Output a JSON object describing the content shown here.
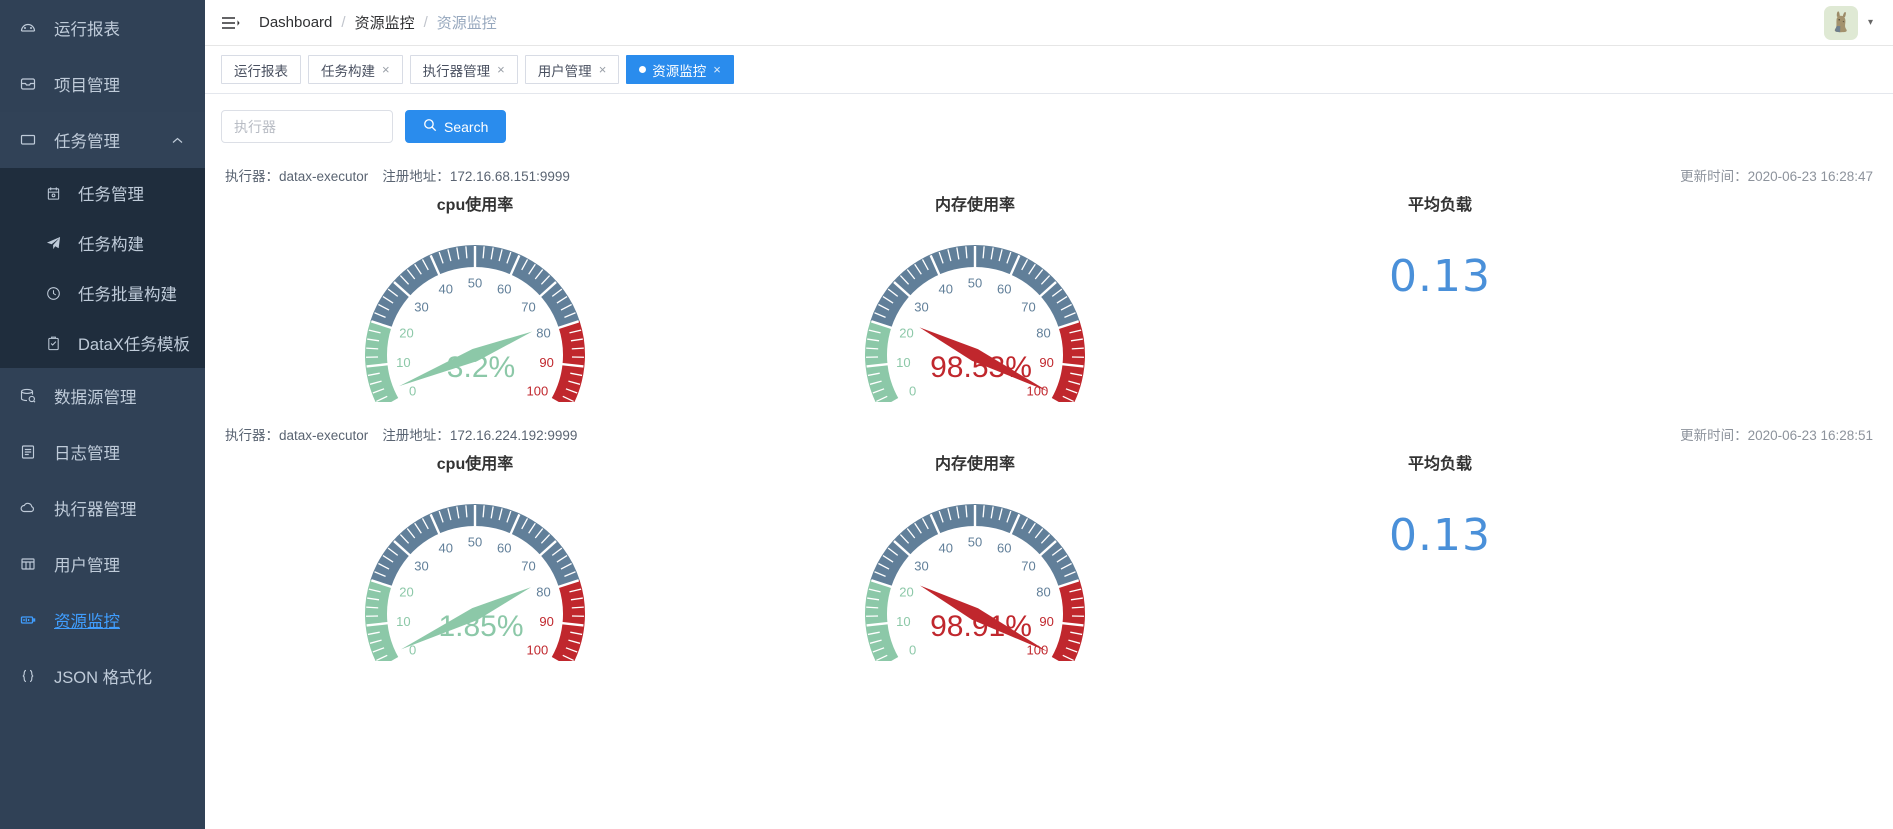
{
  "sidebar": {
    "items": [
      {
        "label": "运行报表",
        "icon": "dashboard-icon",
        "active": false
      },
      {
        "label": "项目管理",
        "icon": "project-icon",
        "active": false
      },
      {
        "label": "任务管理",
        "icon": "task-icon",
        "active": false,
        "expanded": true,
        "children": [
          {
            "label": "任务管理",
            "icon": "calendar-icon"
          },
          {
            "label": "任务构建",
            "icon": "send-icon"
          },
          {
            "label": "任务批量构建",
            "icon": "clock-icon"
          },
          {
            "label": "DataX任务模板",
            "icon": "clipboard-icon"
          }
        ]
      },
      {
        "label": "数据源管理",
        "icon": "database-icon",
        "active": false
      },
      {
        "label": "日志管理",
        "icon": "log-icon",
        "active": false
      },
      {
        "label": "执行器管理",
        "icon": "cloud-icon",
        "active": false
      },
      {
        "label": "用户管理",
        "icon": "grid-icon",
        "active": false
      },
      {
        "label": "资源监控",
        "icon": "monitor-icon",
        "active": true
      },
      {
        "label": "JSON 格式化",
        "icon": "braces-icon",
        "active": false
      }
    ]
  },
  "topbar": {
    "menu_icon": "hamburger-icon",
    "breadcrumb": [
      "Dashboard",
      "资源监控",
      "资源监控"
    ],
    "breadcrumb_separator": "/",
    "avatar_icon": "rabbit-avatar",
    "avatar_caret": "▾"
  },
  "tabs": [
    {
      "label": "运行报表",
      "closable": false,
      "active": false
    },
    {
      "label": "任务构建",
      "closable": true,
      "active": false
    },
    {
      "label": "执行器管理",
      "closable": true,
      "active": false
    },
    {
      "label": "用户管理",
      "closable": true,
      "active": false
    },
    {
      "label": "资源监控",
      "closable": true,
      "active": true
    }
  ],
  "tab_close_glyph": "×",
  "search": {
    "placeholder": "执行器",
    "value": "",
    "button_label": "Search",
    "button_icon": "search-icon"
  },
  "labels": {
    "executor_prefix": "执行器：",
    "address_prefix": "注册地址：",
    "update_prefix": "更新时间：",
    "cpu_title": "cpu使用率",
    "mem_title": "内存使用率",
    "load_title": "平均负载"
  },
  "colors": {
    "accent": "#2a8ced",
    "gauge_green": "#8cc8a8",
    "gauge_blue": "#617f99",
    "gauge_red": "#c0272d",
    "load_blue": "#4a90d9",
    "sidebar_bg": "#304156",
    "submenu_bg": "#1f2d3d"
  },
  "executors": [
    {
      "name": "datax-executor",
      "address": "172.16.68.151:9999",
      "update_time": "2020-06-23 16:28:47",
      "cpu": {
        "value": 3.2,
        "display": "3.2%"
      },
      "mem": {
        "value": 98.53,
        "display": "98.53%"
      },
      "load": {
        "value": 0.13,
        "display": "0.13"
      }
    },
    {
      "name": "datax-executor",
      "address": "172.16.224.192:9999",
      "update_time": "2020-06-23 16:28:51",
      "cpu": {
        "value": 1.85,
        "display": "1.85%"
      },
      "mem": {
        "value": 98.91,
        "display": "98.91%"
      },
      "load": {
        "value": 0.13,
        "display": "0.13"
      }
    }
  ],
  "chart_data": [
    {
      "type": "gauge",
      "title": "cpu使用率",
      "executor_index": 0,
      "value": 3.2,
      "unit": "%",
      "min": 0,
      "max": 100,
      "tick_labels": [
        0,
        10,
        20,
        30,
        40,
        50,
        60,
        70,
        80,
        90,
        100
      ],
      "bands": [
        {
          "from": 0,
          "to": 20,
          "color": "#8cc8a8"
        },
        {
          "from": 20,
          "to": 80,
          "color": "#617f99"
        },
        {
          "from": 80,
          "to": 100,
          "color": "#c0272d"
        }
      ],
      "needle_color": "#8cc8a8",
      "label": "3.2%"
    },
    {
      "type": "gauge",
      "title": "内存使用率",
      "executor_index": 0,
      "value": 98.53,
      "unit": "%",
      "min": 0,
      "max": 100,
      "tick_labels": [
        0,
        10,
        20,
        30,
        40,
        50,
        60,
        70,
        80,
        90,
        100
      ],
      "bands": [
        {
          "from": 0,
          "to": 20,
          "color": "#8cc8a8"
        },
        {
          "from": 20,
          "to": 80,
          "color": "#617f99"
        },
        {
          "from": 80,
          "to": 100,
          "color": "#c0272d"
        }
      ],
      "needle_color": "#c0272d",
      "label": "98.53%"
    },
    {
      "type": "number",
      "title": "平均负载",
      "executor_index": 0,
      "value": 0.13,
      "label": "0.13"
    },
    {
      "type": "gauge",
      "title": "cpu使用率",
      "executor_index": 1,
      "value": 1.85,
      "unit": "%",
      "min": 0,
      "max": 100,
      "tick_labels": [
        0,
        10,
        20,
        30,
        40,
        50,
        60,
        70,
        80,
        90,
        100
      ],
      "bands": [
        {
          "from": 0,
          "to": 20,
          "color": "#8cc8a8"
        },
        {
          "from": 20,
          "to": 80,
          "color": "#617f99"
        },
        {
          "from": 80,
          "to": 100,
          "color": "#c0272d"
        }
      ],
      "needle_color": "#8cc8a8",
      "label": "1.85%"
    },
    {
      "type": "gauge",
      "title": "内存使用率",
      "executor_index": 1,
      "value": 98.91,
      "unit": "%",
      "min": 0,
      "max": 100,
      "tick_labels": [
        0,
        10,
        20,
        30,
        40,
        50,
        60,
        70,
        80,
        90,
        100
      ],
      "bands": [
        {
          "from": 0,
          "to": 20,
          "color": "#8cc8a8"
        },
        {
          "from": 20,
          "to": 80,
          "color": "#617f99"
        },
        {
          "from": 80,
          "to": 100,
          "color": "#c0272d"
        }
      ],
      "needle_color": "#c0272d",
      "label": "98.91%"
    },
    {
      "type": "number",
      "title": "平均负载",
      "executor_index": 1,
      "value": 0.13,
      "label": "0.13"
    }
  ]
}
